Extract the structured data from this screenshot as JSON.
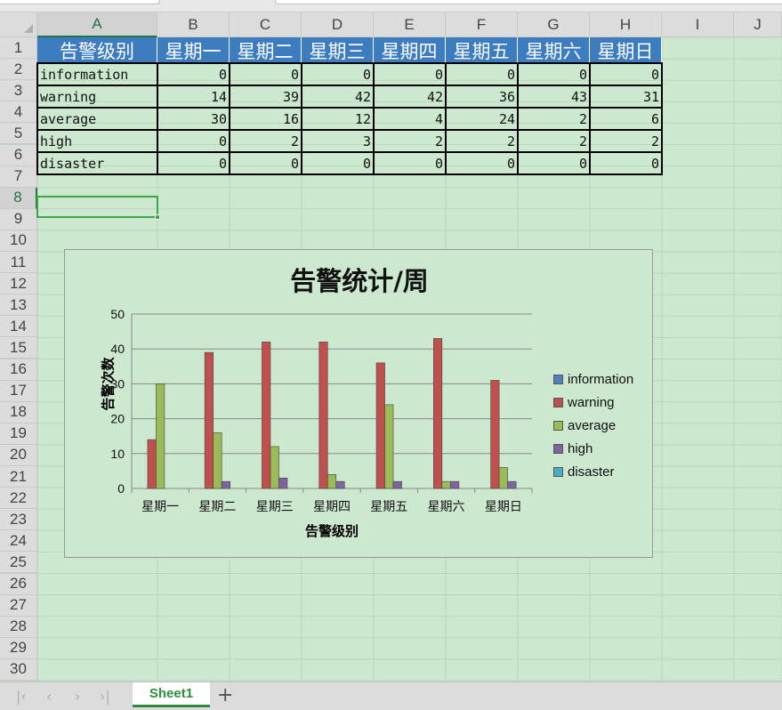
{
  "sheet": {
    "columns": [
      "A",
      "B",
      "C",
      "D",
      "E",
      "F",
      "G",
      "H",
      "I",
      "J"
    ],
    "rows": [
      "1",
      "2",
      "3",
      "4",
      "5",
      "6",
      "7",
      "8",
      "9",
      "10",
      "11",
      "12",
      "13",
      "14",
      "15",
      "16",
      "17",
      "18",
      "19",
      "20",
      "21",
      "22",
      "23",
      "24",
      "25",
      "26",
      "27",
      "28",
      "29",
      "30"
    ],
    "active_row": "8",
    "active_col": "A",
    "header_row": [
      "告警级别",
      "星期一",
      "星期二",
      "星期三",
      "星期四",
      "星期五",
      "星期六",
      "星期日"
    ],
    "data_rows": [
      {
        "label": "information",
        "values": [
          "0",
          "0",
          "0",
          "0",
          "0",
          "0",
          "0"
        ]
      },
      {
        "label": "warning",
        "values": [
          "14",
          "39",
          "42",
          "42",
          "36",
          "43",
          "31"
        ]
      },
      {
        "label": "average",
        "values": [
          "30",
          "16",
          "12",
          "4",
          "24",
          "2",
          "6"
        ]
      },
      {
        "label": "high",
        "values": [
          "0",
          "2",
          "3",
          "2",
          "2",
          "2",
          "2"
        ]
      },
      {
        "label": "disaster",
        "values": [
          "0",
          "0",
          "0",
          "0",
          "0",
          "0",
          "0"
        ]
      }
    ],
    "header_fill": "#3d7dbf",
    "background": "#cce8cf"
  },
  "chart_data": {
    "type": "bar",
    "title": "告警统计/周",
    "xlabel": "告警级别",
    "ylabel": "告警次数",
    "ylim": [
      0,
      50
    ],
    "yticks": [
      "0",
      "10",
      "20",
      "30",
      "40",
      "50"
    ],
    "categories": [
      "星期一",
      "星期二",
      "星期三",
      "星期四",
      "星期五",
      "星期六",
      "星期日"
    ],
    "legend_position": "right",
    "grid": true,
    "series": [
      {
        "name": "information",
        "color": "#4f81bd",
        "values": [
          0,
          0,
          0,
          0,
          0,
          0,
          0
        ]
      },
      {
        "name": "warning",
        "color": "#c0504d",
        "values": [
          14,
          39,
          42,
          42,
          36,
          43,
          31
        ]
      },
      {
        "name": "average",
        "color": "#9bbb59",
        "values": [
          30,
          16,
          12,
          4,
          24,
          2,
          6
        ]
      },
      {
        "name": "high",
        "color": "#8064a2",
        "values": [
          0,
          2,
          3,
          2,
          2,
          2,
          2
        ]
      },
      {
        "name": "disaster",
        "color": "#4bacc6",
        "values": [
          0,
          0,
          0,
          0,
          0,
          0,
          0
        ]
      }
    ]
  },
  "footer": {
    "sheet_tab": "Sheet1",
    "add_sheet": "+",
    "nav": [
      "|‹",
      "‹",
      "›",
      "›|"
    ]
  }
}
